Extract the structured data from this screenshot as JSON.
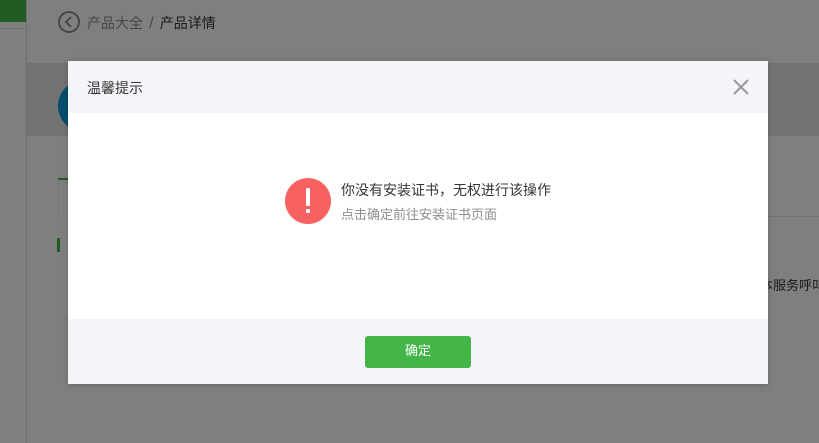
{
  "breadcrumb": {
    "parent": "产品大全",
    "separator": "/",
    "current": "产品详情"
  },
  "background": {
    "partial_text": "本服务呼叫"
  },
  "dialog": {
    "title": "温馨提示",
    "message": "你没有安装证书，无权进行该操作",
    "sub_message": "点击确定前往安装证书页面",
    "confirm_label": "确定"
  },
  "colors": {
    "brand_green": "#44b549",
    "alert_red": "#f86161",
    "header_bg": "#f4f5f9"
  },
  "icons": [
    "back-arrow-icon",
    "close-icon",
    "exclamation-icon"
  ]
}
